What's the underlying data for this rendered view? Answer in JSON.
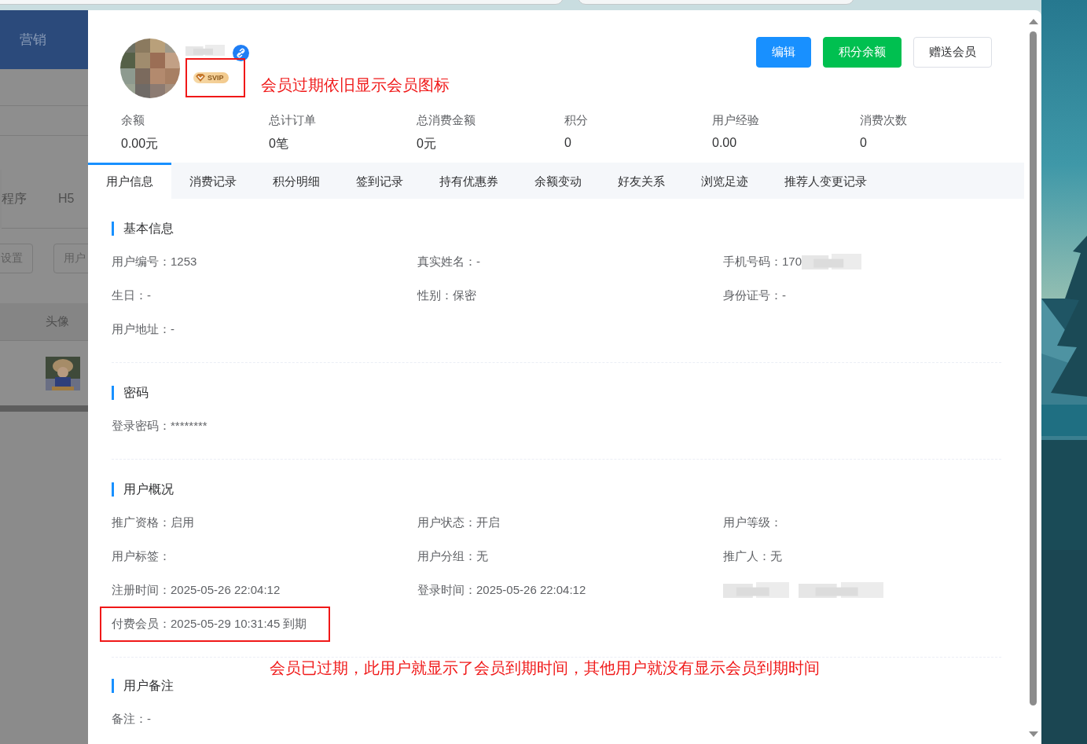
{
  "background_app": {
    "nav_item": "营销",
    "tabs": [
      "程序",
      "H5"
    ],
    "buttons": [
      "设置",
      "用户"
    ],
    "table_header": "头像"
  },
  "drawer": {
    "user": {
      "badge": "SVIP",
      "badge_annotated": true,
      "note": "会员过期依旧显示会员图标"
    },
    "buttons": [
      {
        "label": "编辑",
        "kind": "primary"
      },
      {
        "label": "积分余额",
        "kind": "success"
      },
      {
        "label": "赠送会员",
        "kind": "default"
      }
    ],
    "stats": [
      {
        "label": "余额",
        "value": "0.00元"
      },
      {
        "label": "总计订单",
        "value": "0笔"
      },
      {
        "label": "总消费金额",
        "value": "0元"
      },
      {
        "label": "积分",
        "value": "0"
      },
      {
        "label": "用户经验",
        "value": "0.00"
      },
      {
        "label": "消费次数",
        "value": "0"
      }
    ],
    "tabs": [
      {
        "label": "用户信息",
        "selected": true
      },
      {
        "label": "消费记录",
        "selected": false
      },
      {
        "label": "积分明细",
        "selected": false
      },
      {
        "label": "签到记录",
        "selected": false
      },
      {
        "label": "持有优惠券",
        "selected": false
      },
      {
        "label": "余额变动",
        "selected": false
      },
      {
        "label": "好友关系",
        "selected": false
      },
      {
        "label": "浏览足迹",
        "selected": false
      },
      {
        "label": "推荐人变更记录",
        "selected": false
      }
    ],
    "sections": [
      {
        "title": "基本信息",
        "fields": [
          {
            "kind": "text",
            "text": "用户编号：1253"
          },
          {
            "kind": "text",
            "text": "真实姓名：-"
          },
          {
            "kind": "partly_redacted",
            "text": "手机号码：170"
          },
          {
            "kind": "text",
            "text": "生日：-"
          },
          {
            "kind": "text",
            "text": "性别：保密"
          },
          {
            "kind": "text",
            "text": "身份证号：-"
          },
          {
            "kind": "text",
            "text": "用户地址：-"
          }
        ]
      },
      {
        "title": "密码",
        "fields": [
          {
            "kind": "text",
            "text": "登录密码：********"
          }
        ]
      },
      {
        "title": "用户概况",
        "note": "会员已过期，此用户就显示了会员到期时间，其他用户就没有显示会员到期时间",
        "fields": [
          {
            "kind": "text",
            "text": "推广资格：启用"
          },
          {
            "kind": "text",
            "text": "用户状态：开启"
          },
          {
            "kind": "text",
            "text": "用户等级："
          },
          {
            "kind": "text",
            "text": "用户标签："
          },
          {
            "kind": "text",
            "text": "用户分组：无"
          },
          {
            "kind": "text",
            "text": "推广人：无"
          },
          {
            "kind": "text",
            "text": "注册时间：2025-05-26 22:04:12"
          },
          {
            "kind": "text",
            "text": "登录时间：2025-05-26 22:04:12"
          },
          {
            "kind": "redacted"
          },
          {
            "kind": "text",
            "text": "付费会员：2025-05-29 10:31:45 到期",
            "highlighted": true
          }
        ]
      },
      {
        "title": "用户备注",
        "fields": [
          {
            "kind": "text",
            "text": "备注：-"
          }
        ]
      }
    ]
  }
}
